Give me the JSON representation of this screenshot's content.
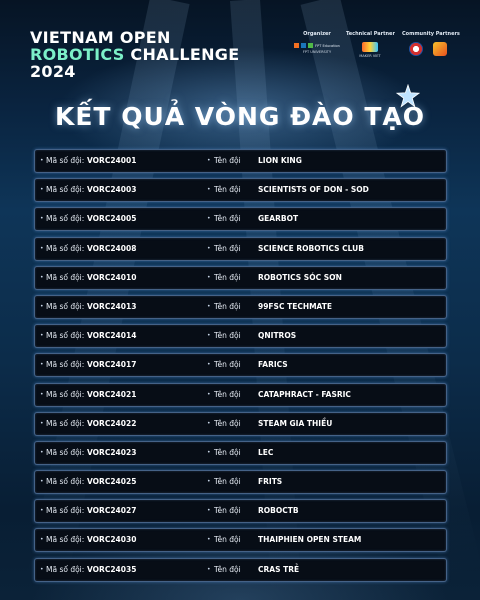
{
  "header": {
    "title_line1": "VIETNAM OPEN",
    "title_line2_accent": "ROBOTICS",
    "title_line2_rest": " CHALLENGE",
    "title_line3": "2024"
  },
  "partners": {
    "organizer_label": "Organizer",
    "organizer_logo_text": "FPT Education",
    "organizer_sub": "FPT UNIVERSITY",
    "technical_label": "Technical Partner",
    "technical_logo_text": "MAKER VIET",
    "community_label": "Community Partners"
  },
  "main_title": "KẾT QUẢ VÒNG ĐÀO TẠO",
  "labels": {
    "team_code": "Mã số đội:",
    "team_name": "Tên đội"
  },
  "teams": [
    {
      "code": "VORC24001",
      "name": "LION KING"
    },
    {
      "code": "VORC24003",
      "name": "SCIENTISTS OF DON - SOD"
    },
    {
      "code": "VORC24005",
      "name": "GEARBOT"
    },
    {
      "code": "VORC24008",
      "name": "SCIENCE ROBOTICS CLUB"
    },
    {
      "code": "VORC24010",
      "name": "ROBOTICS SÓC SƠN"
    },
    {
      "code": "VORC24013",
      "name": "99FSC TECHMATE"
    },
    {
      "code": "VORC24014",
      "name": "QNITROS"
    },
    {
      "code": "VORC24017",
      "name": "FARICS"
    },
    {
      "code": "VORC24021",
      "name": "CATAPHRACT - FASRIC"
    },
    {
      "code": "VORC24022",
      "name": "STEAM GIA THIỀU"
    },
    {
      "code": "VORC24023",
      "name": "LEC"
    },
    {
      "code": "VORC24025",
      "name": "FRITS"
    },
    {
      "code": "VORC24027",
      "name": "ROBOCTB"
    },
    {
      "code": "VORC24030",
      "name": "THAIPHIEN OPEN STEAM"
    },
    {
      "code": "VORC24035",
      "name": "CRAS TRẺ"
    }
  ],
  "colors": {
    "accent_mint": "#7cf0c8",
    "row_background": "#070d16",
    "row_border": "#78aae6"
  }
}
